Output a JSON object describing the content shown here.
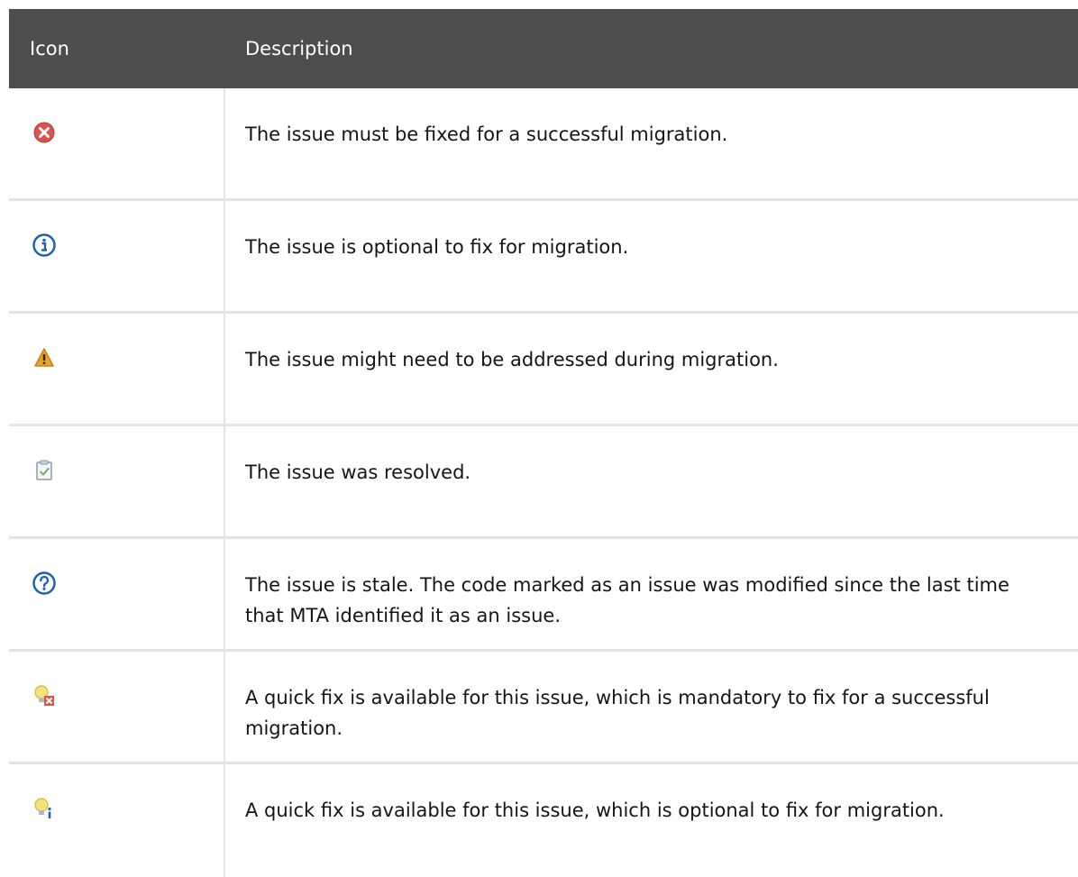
{
  "table": {
    "headers": {
      "icon": "Icon",
      "description": "Description"
    },
    "rows": [
      {
        "icon": "error-icon",
        "description": "The issue must be fixed for a successful migration."
      },
      {
        "icon": "info-icon",
        "description": "The issue is optional to fix for migration."
      },
      {
        "icon": "warning-icon",
        "description": "The issue might need to be addressed during migration."
      },
      {
        "icon": "resolved-icon",
        "description": "The issue was resolved."
      },
      {
        "icon": "stale-icon",
        "description": "The issue is stale. The code marked as an issue was modified since the last time that MTA identified it as an issue."
      },
      {
        "icon": "quickfix-mandatory-icon",
        "description": "A quick fix is available for this issue, which is mandatory to fix for a successful migration."
      },
      {
        "icon": "quickfix-optional-icon",
        "description": "A quick fix is available for this issue, which is optional to fix for migration."
      }
    ]
  },
  "colors": {
    "header_bg": "#4d4d4d",
    "error": "#d9534f",
    "info": "#1e62b0",
    "warning": "#e8a32b",
    "border": "#e4e4e4"
  }
}
